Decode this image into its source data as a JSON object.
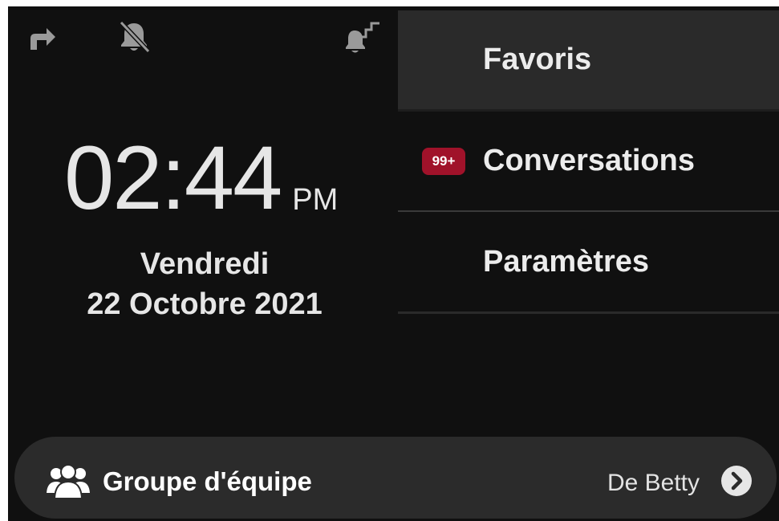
{
  "status_bar": {
    "icons": [
      "call-forward-icon",
      "bell-muted-icon",
      "bell-step-icon"
    ]
  },
  "clock": {
    "time": "02:44",
    "ampm": "PM"
  },
  "date": {
    "day": "Vendredi",
    "full": "22 Octobre 2021"
  },
  "menu": {
    "items": [
      {
        "label": "Favoris",
        "badge": null
      },
      {
        "label": "Conversations",
        "badge": "99+"
      },
      {
        "label": "Paramètres",
        "badge": null
      }
    ]
  },
  "team_group": {
    "label": "Groupe d'équipe",
    "from": "De Betty"
  },
  "colors": {
    "background": "#101010",
    "panel_active": "#2a2a2a",
    "badge": "#a0122a",
    "text": "#e6e6e6"
  }
}
